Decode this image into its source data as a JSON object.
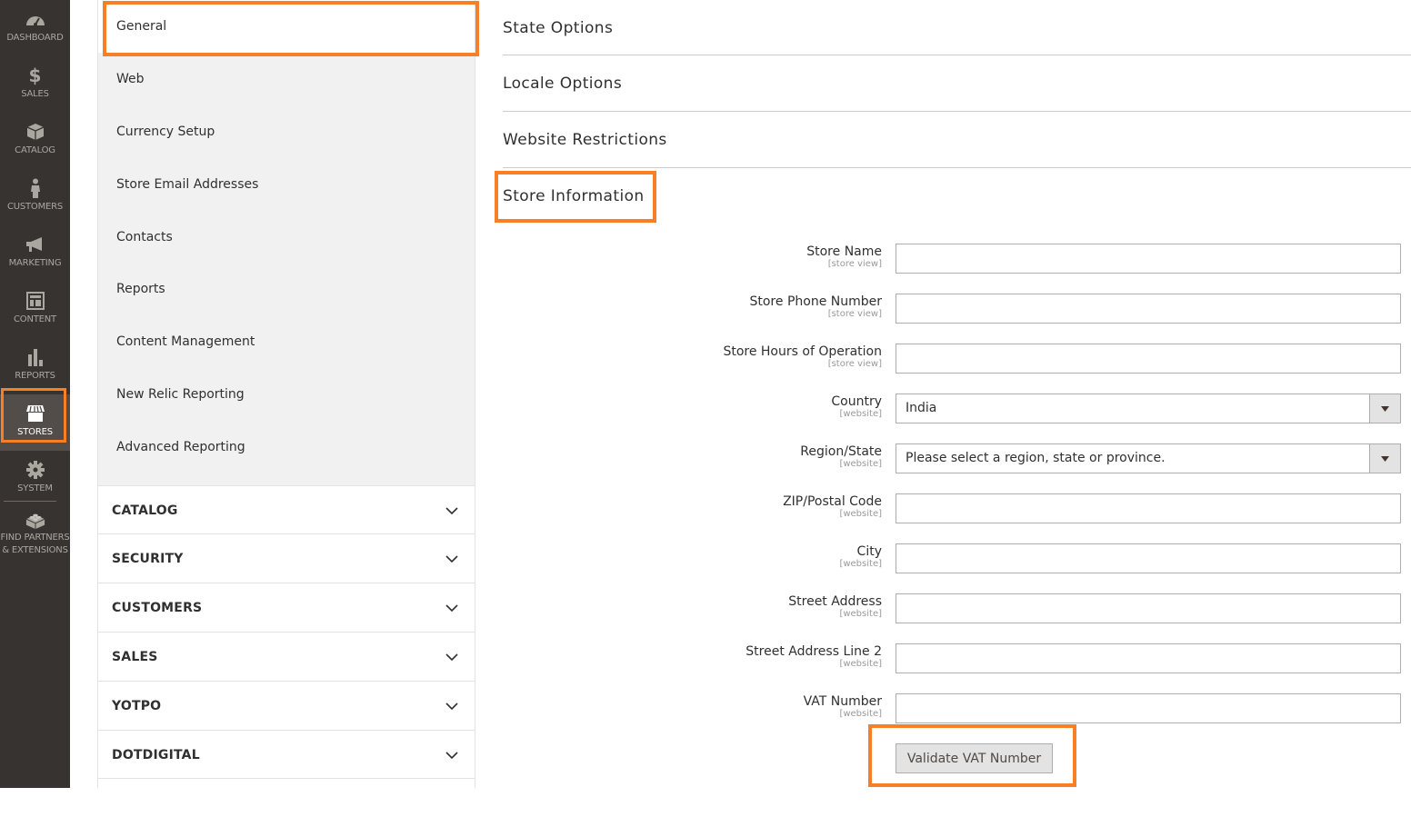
{
  "admin_nav": {
    "items": [
      {
        "label": "DASHBOARD",
        "icon": "dashboard-icon"
      },
      {
        "label": "SALES",
        "icon": "dollar-icon"
      },
      {
        "label": "CATALOG",
        "icon": "box-icon"
      },
      {
        "label": "CUSTOMERS",
        "icon": "person-icon"
      },
      {
        "label": "MARKETING",
        "icon": "megaphone-icon"
      },
      {
        "label": "CONTENT",
        "icon": "layout-icon"
      },
      {
        "label": "REPORTS",
        "icon": "bar-chart-icon"
      },
      {
        "label": "STORES",
        "icon": "storefront-icon",
        "active": true
      },
      {
        "label": "SYSTEM",
        "icon": "gear-icon"
      },
      {
        "label": "FIND PARTNERS",
        "label2": "& EXTENSIONS",
        "icon": "lego-brick-icon"
      }
    ]
  },
  "config_tabs": {
    "general_items": [
      {
        "label": "General",
        "active": true
      },
      {
        "label": "Web"
      },
      {
        "label": "Currency Setup"
      },
      {
        "label": "Store Email Addresses"
      },
      {
        "label": "Contacts"
      },
      {
        "label": "Reports"
      },
      {
        "label": "Content Management"
      },
      {
        "label": "New Relic Reporting"
      },
      {
        "label": "Advanced Reporting"
      }
    ],
    "groups": [
      {
        "label": "CATALOG"
      },
      {
        "label": "SECURITY"
      },
      {
        "label": "CUSTOMERS"
      },
      {
        "label": "SALES"
      },
      {
        "label": "YOTPO"
      },
      {
        "label": "DOTDIGITAL"
      }
    ]
  },
  "sections": [
    {
      "title": "State Options"
    },
    {
      "title": "Locale Options"
    },
    {
      "title": "Website Restrictions"
    },
    {
      "title": "Store Information",
      "expanded": true
    }
  ],
  "store_information": {
    "fields": [
      {
        "label": "Store Name",
        "scope": "[store view]",
        "type": "text",
        "value": ""
      },
      {
        "label": "Store Phone Number",
        "scope": "[store view]",
        "type": "text",
        "value": ""
      },
      {
        "label": "Store Hours of Operation",
        "scope": "[store view]",
        "type": "text",
        "value": ""
      },
      {
        "label": "Country",
        "scope": "[website]",
        "type": "select",
        "value": "India"
      },
      {
        "label": "Region/State",
        "scope": "[website]",
        "type": "select",
        "value": "Please select a region, state or province."
      },
      {
        "label": "ZIP/Postal Code",
        "scope": "[website]",
        "type": "text",
        "value": ""
      },
      {
        "label": "City",
        "scope": "[website]",
        "type": "text",
        "value": ""
      },
      {
        "label": "Street Address",
        "scope": "[website]",
        "type": "text",
        "value": ""
      },
      {
        "label": "Street Address Line 2",
        "scope": "[website]",
        "type": "text",
        "value": ""
      },
      {
        "label": "VAT Number",
        "scope": "[website]",
        "type": "text",
        "value": ""
      }
    ],
    "validate_button": "Validate VAT Number"
  },
  "colors": {
    "highlight": "#f97f27",
    "nav_bg": "#373330",
    "nav_active_bg": "#524d49"
  }
}
